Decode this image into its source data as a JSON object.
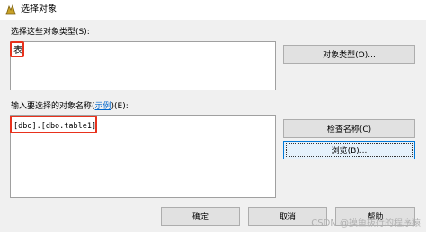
{
  "window": {
    "title": "选择对象"
  },
  "object_types": {
    "label": "选择这些对象类型(S):",
    "value": "表",
    "button_label": "对象类型(O)..."
  },
  "object_names": {
    "label_prefix": "输入要选择的对象名称(",
    "label_link": "示例",
    "label_suffix": ")(E):",
    "value": "[dbo].[dbo.table1]",
    "check_names_label": "检查名称(C)",
    "browse_label": "浏览(B)..."
  },
  "footer": {
    "ok_label": "确定",
    "cancel_label": "取消",
    "help_label": "帮助"
  },
  "watermark": "CSDN @摸鱼拔行的程序猿",
  "colors": {
    "highlight": "#e8321d",
    "focus": "#0078d7"
  }
}
